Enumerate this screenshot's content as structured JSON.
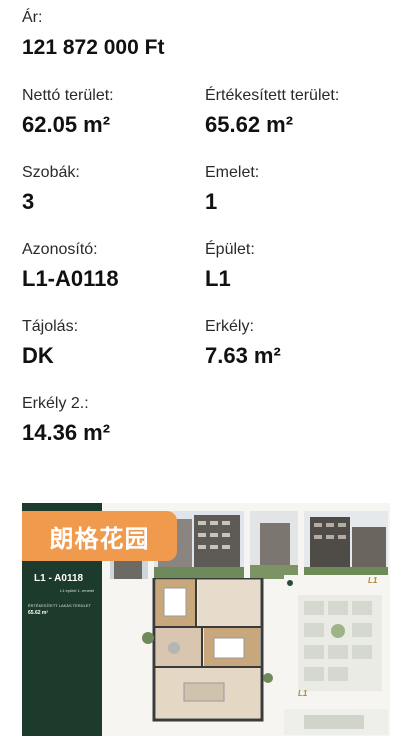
{
  "fields": {
    "price": {
      "label": "Ár:",
      "value": "121 872 000 Ft"
    },
    "net_area": {
      "label": "Nettó terület:",
      "value": "62.05 m²"
    },
    "sold_area": {
      "label": "Értékesített terület:",
      "value": "65.62 m²"
    },
    "rooms": {
      "label": "Szobák:",
      "value": "3"
    },
    "floor": {
      "label": "Emelet:",
      "value": "1"
    },
    "id": {
      "label": "Azonosító:",
      "value": "L1-A0118"
    },
    "building": {
      "label": "Épület:",
      "value": "L1"
    },
    "orientation": {
      "label": "Tájolás:",
      "value": "DK"
    },
    "balcony": {
      "label": "Erkély:",
      "value": "7.63 m²"
    },
    "balcony2": {
      "label": "Erkély 2.:",
      "value": "14.36 m²"
    }
  },
  "brochure": {
    "watermark": "朗格花园",
    "unit_title": "L1 - A0118",
    "unit_sub": "L1 épület 1. emelet",
    "sold_area_heading": "ÉRTÉKESÍTETT LAKÁS TERÜLET",
    "sold_area_value": "65.62 m²",
    "site_badge": "L1",
    "site_badge_2": "L1",
    "colors": {
      "panel": "#1d3b2c",
      "watermark_bg": "#f09a4e",
      "accent": "#b08a36"
    }
  }
}
